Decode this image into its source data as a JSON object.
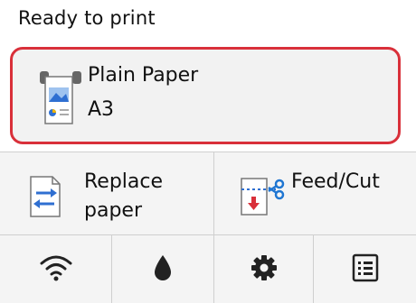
{
  "status": {
    "text": "Ready to print"
  },
  "paper": {
    "type": "Plain Paper",
    "size": "A3",
    "icon": "paper-roll-icon"
  },
  "actions": {
    "replace": {
      "label": "Replace paper",
      "icon": "replace-paper-icon"
    },
    "feed": {
      "label": "Feed/Cut",
      "icon": "feed-cut-icon"
    }
  },
  "nav": [
    {
      "name": "wifi",
      "icon": "wifi-icon"
    },
    {
      "name": "ink",
      "icon": "ink-drop-icon"
    },
    {
      "name": "settings",
      "icon": "gear-icon"
    },
    {
      "name": "menu",
      "icon": "list-icon"
    }
  ],
  "colors": {
    "accent_red": "#d9303a",
    "icon_blue": "#2f6fd1",
    "scissor_blue": "#1f76d2",
    "arrow_red": "#d9303a",
    "background": "#f4f4f4"
  }
}
